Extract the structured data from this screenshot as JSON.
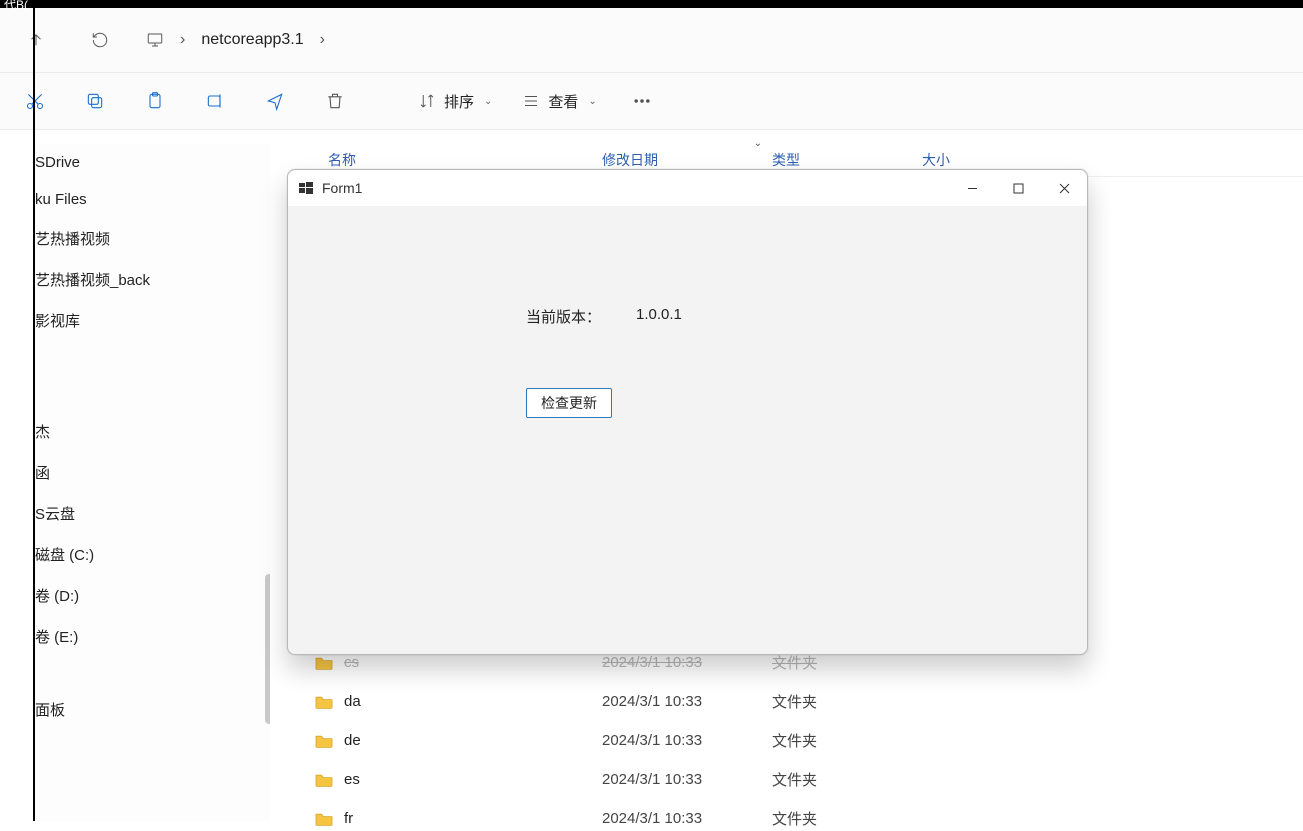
{
  "top_strip": "代B(",
  "nav": {
    "crumb": "netcoreapp3.1"
  },
  "toolbar": {
    "sort": "排序",
    "view": "查看"
  },
  "columns": {
    "name": "名称",
    "date": "修改日期",
    "type": "类型",
    "size": "大小"
  },
  "sidebar": {
    "items_top": [
      "SDrive",
      "ku Files",
      "艺热播视频",
      "艺热播视频_back",
      "影视库"
    ],
    "items_mid": [
      "杰",
      "函",
      "S云盘",
      "磁盘 (C:)",
      "卷 (D:)",
      "卷 (E:)"
    ],
    "items_bot": [
      "面板"
    ]
  },
  "rows": [
    {
      "name": "cs",
      "date": "2024/3/1 10:33",
      "type": "文件夹"
    },
    {
      "name": "da",
      "date": "2024/3/1 10:33",
      "type": "文件夹"
    },
    {
      "name": "de",
      "date": "2024/3/1 10:33",
      "type": "文件夹"
    },
    {
      "name": "es",
      "date": "2024/3/1 10:33",
      "type": "文件夹"
    },
    {
      "name": "fr",
      "date": "2024/3/1 10:33",
      "type": "文件夹"
    }
  ],
  "dialog": {
    "title": "Form1",
    "version_label": "当前版本：",
    "version_value": "1.0.0.1",
    "check_button": "检查更新"
  }
}
